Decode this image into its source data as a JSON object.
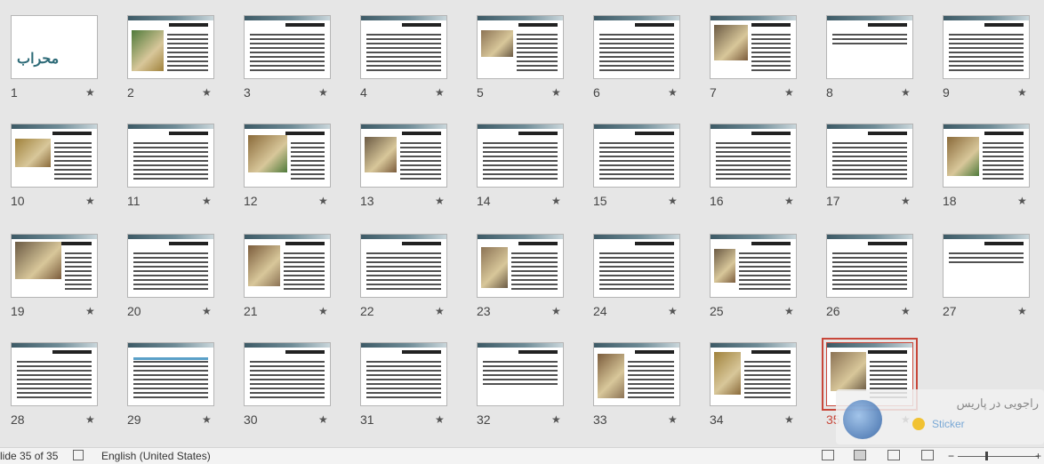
{
  "slides": [
    {
      "number": "1",
      "title_text": "محراب"
    },
    {
      "number": "2"
    },
    {
      "number": "3"
    },
    {
      "number": "4"
    },
    {
      "number": "5"
    },
    {
      "number": "6"
    },
    {
      "number": "7"
    },
    {
      "number": "8"
    },
    {
      "number": "9"
    },
    {
      "number": "10"
    },
    {
      "number": "11"
    },
    {
      "number": "12"
    },
    {
      "number": "13"
    },
    {
      "number": "14"
    },
    {
      "number": "15"
    },
    {
      "number": "16"
    },
    {
      "number": "17"
    },
    {
      "number": "18"
    },
    {
      "number": "19"
    },
    {
      "number": "20"
    },
    {
      "number": "21"
    },
    {
      "number": "22"
    },
    {
      "number": "23"
    },
    {
      "number": "24"
    },
    {
      "number": "25"
    },
    {
      "number": "26"
    },
    {
      "number": "27"
    },
    {
      "number": "28"
    },
    {
      "number": "29"
    },
    {
      "number": "30"
    },
    {
      "number": "31"
    },
    {
      "number": "32"
    },
    {
      "number": "33"
    },
    {
      "number": "34"
    },
    {
      "number": "35"
    }
  ],
  "selected_slide": "35",
  "star_glyph": "★",
  "statusbar": {
    "slide_info": "lide 35 of 35",
    "language": "English (United States)",
    "notes_icon": "notes-icon",
    "views": [
      "normal-view-icon",
      "slide-sorter-icon",
      "reading-view-icon",
      "slideshow-icon"
    ],
    "zoom_minus": "−",
    "zoom_plus": "+"
  },
  "sticker": {
    "text": "راجویی در پاریس",
    "sub": "Sticker"
  },
  "colors": {
    "selection": "#c8473a",
    "background": "#e6e6e6",
    "band": "#3d5a66"
  }
}
